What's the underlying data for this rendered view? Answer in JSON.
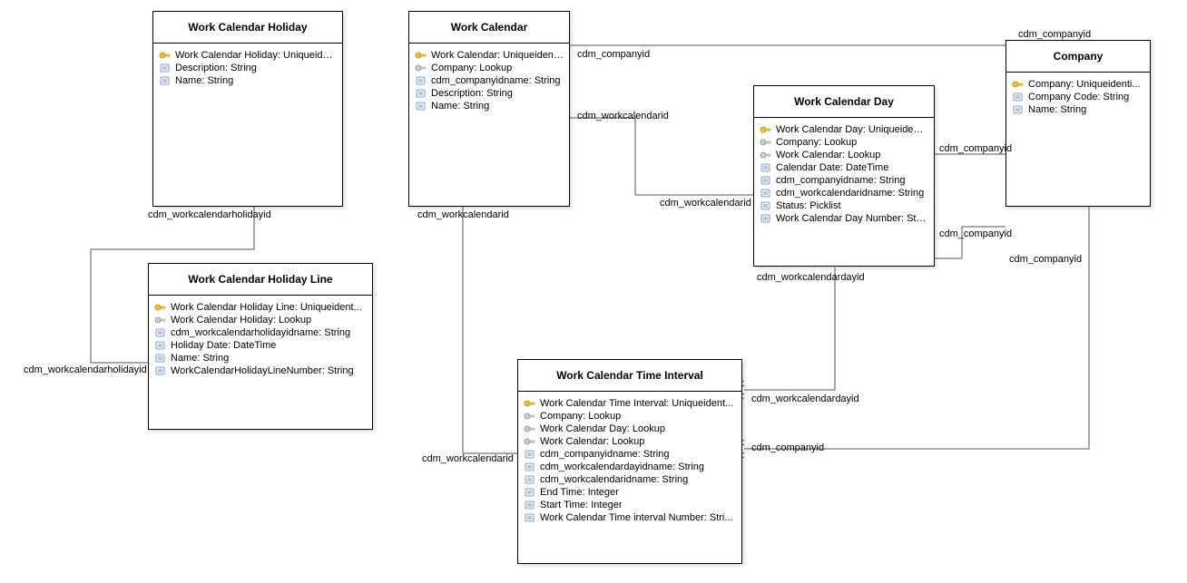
{
  "entities": {
    "workCalendarHoliday": {
      "title": "Work Calendar Holiday",
      "attrs": [
        {
          "icon": "pk",
          "label": "Work Calendar Holiday: Uniqueident..."
        },
        {
          "icon": "field",
          "label": "Description: String"
        },
        {
          "icon": "field",
          "label": "Name: String"
        }
      ]
    },
    "workCalendar": {
      "title": "Work Calendar",
      "attrs": [
        {
          "icon": "pk",
          "label": "Work Calendar: Uniqueident..."
        },
        {
          "icon": "fk",
          "label": "Company: Lookup"
        },
        {
          "icon": "field",
          "label": "cdm_companyidname: String"
        },
        {
          "icon": "field",
          "label": "Description: String"
        },
        {
          "icon": "field",
          "label": "Name: String"
        }
      ]
    },
    "company": {
      "title": "Company",
      "attrs": [
        {
          "icon": "pk",
          "label": "Company: Uniqueidenti..."
        },
        {
          "icon": "field",
          "label": "Company Code: String"
        },
        {
          "icon": "field",
          "label": "Name: String"
        }
      ]
    },
    "workCalendarDay": {
      "title": "Work Calendar Day",
      "attrs": [
        {
          "icon": "pk",
          "label": "Work Calendar Day: Uniqueident..."
        },
        {
          "icon": "fk",
          "label": "Company: Lookup"
        },
        {
          "icon": "fk",
          "label": "Work Calendar: Lookup"
        },
        {
          "icon": "field",
          "label": "Calendar Date: DateTime"
        },
        {
          "icon": "field",
          "label": "cdm_companyidname: String"
        },
        {
          "icon": "field",
          "label": "cdm_workcalendaridname: String"
        },
        {
          "icon": "field",
          "label": "Status: Picklist"
        },
        {
          "icon": "field",
          "label": "Work Calendar Day Number: Stri..."
        }
      ]
    },
    "workCalendarHolidayLine": {
      "title": "Work Calendar Holiday Line",
      "attrs": [
        {
          "icon": "pk",
          "label": "Work Calendar Holiday Line: Uniqueident..."
        },
        {
          "icon": "fk",
          "label": "Work Calendar Holiday: Lookup"
        },
        {
          "icon": "field",
          "label": "cdm_workcalendarholidayidname: String"
        },
        {
          "icon": "field",
          "label": "Holiday Date: DateTime"
        },
        {
          "icon": "field",
          "label": "Name: String"
        },
        {
          "icon": "field",
          "label": "WorkCalendarHolidayLineNumber: String"
        }
      ]
    },
    "workCalendarTimeInterval": {
      "title": "Work Calendar Time Interval",
      "attrs": [
        {
          "icon": "pk",
          "label": "Work Calendar Time Interval: Uniqueident..."
        },
        {
          "icon": "fk",
          "label": "Company: Lookup"
        },
        {
          "icon": "fk",
          "label": "Work Calendar Day: Lookup"
        },
        {
          "icon": "fk",
          "label": "Work Calendar: Lookup"
        },
        {
          "icon": "field",
          "label": "cdm_companyidname: String"
        },
        {
          "icon": "field",
          "label": "cdm_workcalendardayidname: String"
        },
        {
          "icon": "field",
          "label": "cdm_workcalendaridname: String"
        },
        {
          "icon": "field",
          "label": "End Time: Integer"
        },
        {
          "icon": "field",
          "label": "Start Time: Integer"
        },
        {
          "icon": "field",
          "label": "Work Calendar Time interval Number: Stri..."
        }
      ]
    }
  },
  "labels": {
    "l1": "cdm_workcalendarholidayid",
    "l2": "cdm_workcalendarholidayid",
    "l3": "cdm_workcalendarid",
    "l4": "cdm_workcalendarid",
    "l5": "cdm_companyid",
    "l6": "cdm_workcalendarid",
    "l7": "cdm_workcalendarid",
    "l8": "cdm_companyid",
    "l9": "cdm_workcalendardayid",
    "l10": "cdm_companyid",
    "l11": "cdm_workcalendardayid",
    "l12": "cdm_companyid",
    "l13": "cdm_companyid",
    "l14": "cdm_companyid"
  }
}
